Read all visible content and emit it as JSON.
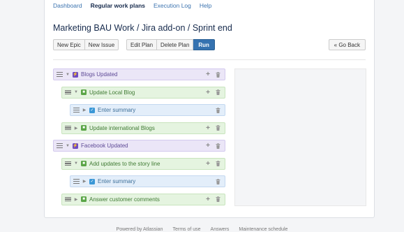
{
  "nav": {
    "items": [
      {
        "label": "Dashboard",
        "active": false
      },
      {
        "label": "Regular work plans",
        "active": true
      },
      {
        "label": "Execution Log",
        "active": false
      },
      {
        "label": "Help",
        "active": false
      }
    ]
  },
  "page": {
    "title": "Marketing BAU Work / Jira add-on / Sprint end"
  },
  "toolbar": {
    "new_epic": "New Epic",
    "new_issue": "New Issue",
    "edit_plan": "Edit Plan",
    "delete_plan": "Delete Plan",
    "run": "Run",
    "go_back": "« Go Back"
  },
  "tree": {
    "rows": [
      {
        "type": "epic",
        "label": "Blogs Updated",
        "expanded": true,
        "add": true
      },
      {
        "type": "story",
        "label": "Update Local Blog",
        "expanded": true,
        "add": true
      },
      {
        "type": "sub",
        "label": "Enter summary",
        "expanded": false,
        "add": false
      },
      {
        "type": "story",
        "label": "Update international Blogs",
        "expanded": false,
        "add": true
      },
      {
        "type": "epic",
        "label": "Facebook Updated",
        "expanded": true,
        "add": true
      },
      {
        "type": "story",
        "label": "Add updates to the story line",
        "expanded": true,
        "add": true
      },
      {
        "type": "sub",
        "label": "Enter summary",
        "expanded": false,
        "add": false
      },
      {
        "type": "story",
        "label": "Answer customer comments",
        "expanded": false,
        "add": true
      }
    ]
  },
  "footer": {
    "links": [
      "Powered by Atlassian",
      "Terms of use",
      "Answers",
      "Maintenance schedule"
    ]
  },
  "colors": {
    "link": "#3b73af",
    "primary_button": "#3572b0",
    "epic": "#6f4bc2",
    "story": "#5aa547",
    "subtask": "#3a97d6"
  }
}
